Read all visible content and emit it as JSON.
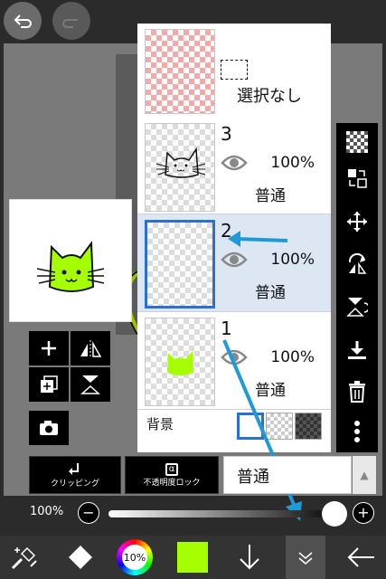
{
  "layers": [
    {
      "num": "",
      "label": "選択なし",
      "opacity": "",
      "blend": "",
      "thumb": "red"
    },
    {
      "num": "3",
      "label": "",
      "opacity": "100%",
      "blend": "普通",
      "thumb": "cat"
    },
    {
      "num": "2",
      "label": "",
      "opacity": "100%",
      "blend": "普通",
      "thumb": "empty"
    },
    {
      "num": "1",
      "label": "",
      "opacity": "100%",
      "blend": "普通",
      "thumb": "green"
    }
  ],
  "background_label": "背景",
  "options": {
    "clipping_label": "クリッピング",
    "alpha_lock_label": "不透明度ロック",
    "alpha_symbol": "α",
    "blend_mode": "普通"
  },
  "opacity_slider": {
    "label": "100%",
    "value": 1.0,
    "minus": "−",
    "plus": "+"
  },
  "colors": {
    "accent_blue": "#2a6fd1",
    "annotation_arrow": "#1f9ad6",
    "current_color": "#a6ff00",
    "selected_row": "#dde7f4"
  },
  "color_wheel_label": "10%",
  "icons": {
    "top": [
      "undo-icon",
      "redo-icon"
    ],
    "right_tools": [
      "transparency-icon",
      "swap-layers-icon",
      "move-icon",
      "flip-horizontal-icon",
      "flip-vertical-icon",
      "merge-down-icon",
      "trash-icon",
      "more-icon"
    ],
    "left_tools": [
      "add-layer-icon",
      "flip-horizontal-icon",
      "duplicate-layer-icon",
      "flip-vertical-icon",
      "camera-icon"
    ],
    "bottom": [
      "brush-settings-icon",
      "eraser-icon",
      "color-wheel-icon",
      "current-color-swatch",
      "down-arrow-icon",
      "chevron-down-icon",
      "back-arrow-icon"
    ]
  }
}
